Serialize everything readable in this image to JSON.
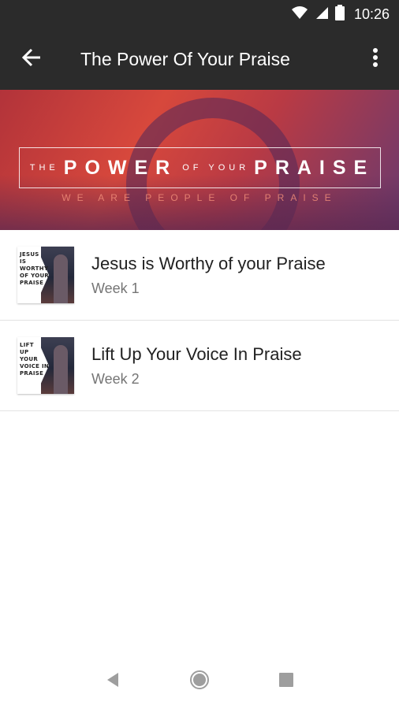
{
  "status_bar": {
    "time": "10:26",
    "icons": [
      "wifi-icon",
      "signal-icon",
      "battery-icon"
    ]
  },
  "app_bar": {
    "title": "The Power Of Your Praise",
    "icons": [
      "back-arrow-icon",
      "more-vertical-icon"
    ]
  },
  "banner": {
    "the": "THE",
    "power": "POWER",
    "of_your": "OF YOUR",
    "praise": "PRAISE",
    "subtitle": "WE ARE PEOPLE OF PRAISE"
  },
  "items": [
    {
      "title": "Jesus is Worthy of your Praise",
      "subtitle": "Week 1",
      "thumb_text": "JESUS\nIS\nWORTHY\nOF YOUR\nPRAISE"
    },
    {
      "title": "Lift Up Your Voice In Praise",
      "subtitle": "Week 2",
      "thumb_text": "LIFT\nUP\nYOUR\nVOICE IN\nPRAISE"
    }
  ],
  "nav_bar": {
    "icons": [
      "nav-back-icon",
      "nav-home-icon",
      "nav-recents-icon"
    ]
  },
  "colors": {
    "app_bar": "#2b2b2b",
    "banner_red": "#d7483c",
    "divider": "#e3e3e3"
  }
}
